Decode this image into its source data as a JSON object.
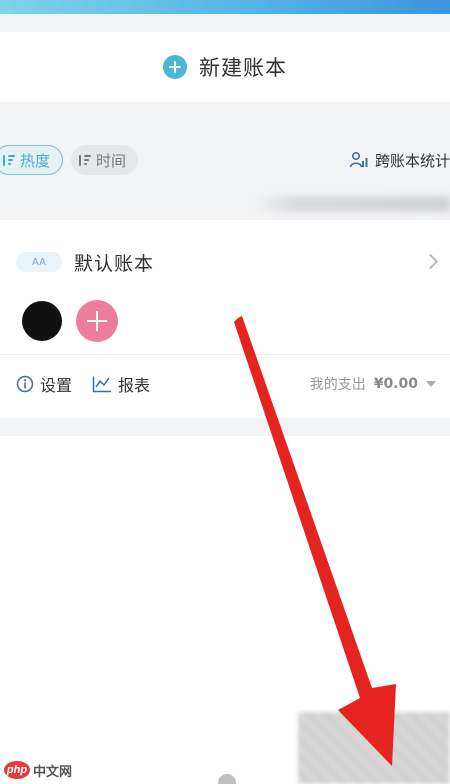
{
  "new_book": {
    "label": "新建账本"
  },
  "sort": {
    "hot_label": "热度",
    "time_label": "时间"
  },
  "cross_stats": {
    "label": "跨账本统计"
  },
  "book": {
    "badge": "AA",
    "name": "默认账本",
    "settings_label": "设置",
    "report_label": "报表",
    "expense_label": "我的支出",
    "expense_amount": "¥0.00"
  },
  "watermark": {
    "logo": "php",
    "text": "中文网"
  },
  "colors": {
    "accent": "#4bb7d6",
    "add_member": "#ec7e9c",
    "arrow": "#e52421"
  }
}
